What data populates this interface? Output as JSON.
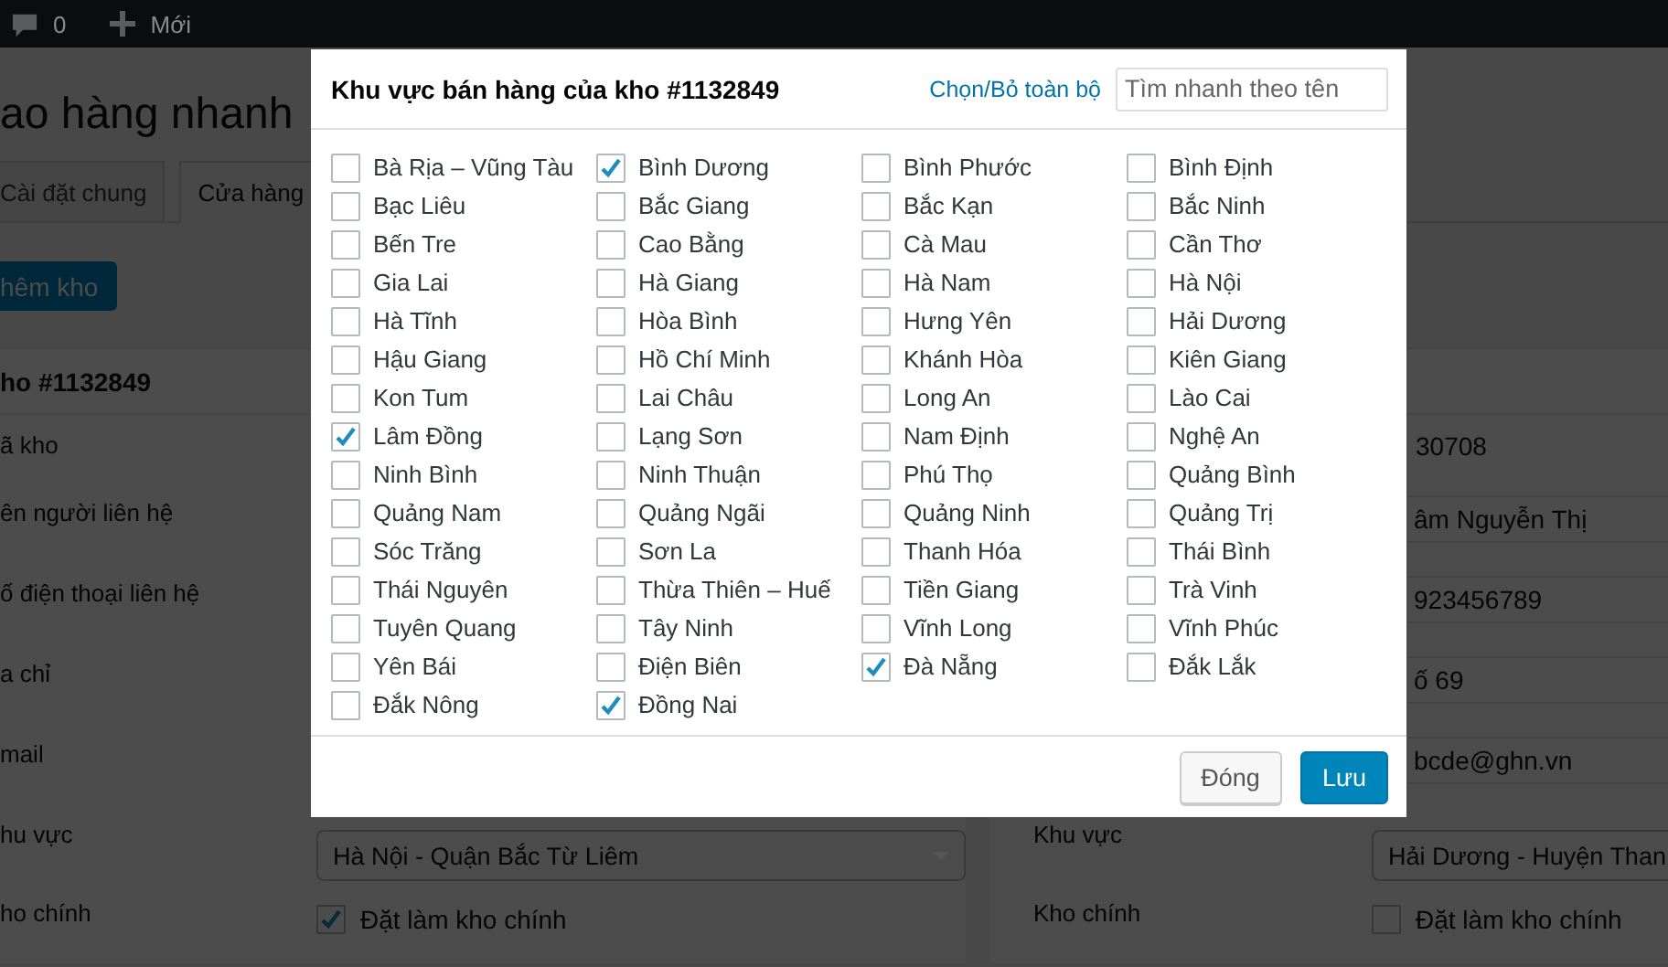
{
  "admin_bar": {
    "comments_count": "0",
    "new_label": "Mới"
  },
  "page_title": "ao hàng nhanh",
  "tabs": [
    {
      "label": "Cài đặt chung",
      "selected": false
    },
    {
      "label": "Cửa hàng",
      "selected": true
    }
  ],
  "add_button": "hêm kho",
  "warehouse_left": {
    "title": "ho #1132849",
    "labels": [
      "ã kho",
      "ên người liên hệ",
      "ố điện thoại liên hệ",
      "a chỉ",
      "mail",
      "hu vực",
      "ho chính"
    ],
    "region_select": "Hà Nội - Quận Bắc Từ Liêm",
    "main_checkbox": {
      "label": "Đặt làm kho chính",
      "checked": true
    }
  },
  "warehouse_right": {
    "code": "30708",
    "inputs": [
      "âm Nguyễn Thị",
      "923456789",
      "ố 69",
      "bcde@ghn.vn"
    ],
    "region_label": "Khu vực",
    "region_select": "Hải Dương - Huyện Than",
    "main_label": "Kho chính",
    "main_checkbox": {
      "label": "Đặt làm kho chính",
      "checked": false
    }
  },
  "dialog": {
    "title": "Khu vực bán hàng của kho #1132849",
    "toggle_all_link": "Chọn/Bỏ toàn bộ",
    "search": {
      "placeholder": "Tìm nhanh theo tên"
    },
    "provinces": [
      {
        "name": "Bà Rịa – Vũng Tàu",
        "checked": false
      },
      {
        "name": "Bình Dương",
        "checked": true
      },
      {
        "name": "Bình Phước",
        "checked": false
      },
      {
        "name": "Bình Định",
        "checked": false
      },
      {
        "name": "Bạc Liêu",
        "checked": false
      },
      {
        "name": "Bắc Giang",
        "checked": false
      },
      {
        "name": "Bắc Kạn",
        "checked": false
      },
      {
        "name": "Bắc Ninh",
        "checked": false
      },
      {
        "name": "Bến Tre",
        "checked": false
      },
      {
        "name": "Cao Bằng",
        "checked": false
      },
      {
        "name": "Cà Mau",
        "checked": false
      },
      {
        "name": "Cần Thơ",
        "checked": false
      },
      {
        "name": "Gia Lai",
        "checked": false
      },
      {
        "name": "Hà Giang",
        "checked": false
      },
      {
        "name": "Hà Nam",
        "checked": false
      },
      {
        "name": "Hà Nội",
        "checked": false
      },
      {
        "name": "Hà Tĩnh",
        "checked": false
      },
      {
        "name": "Hòa Bình",
        "checked": false
      },
      {
        "name": "Hưng Yên",
        "checked": false
      },
      {
        "name": "Hải Dương",
        "checked": false
      },
      {
        "name": "Hậu Giang",
        "checked": false
      },
      {
        "name": "Hồ Chí Minh",
        "checked": false
      },
      {
        "name": "Khánh Hòa",
        "checked": false
      },
      {
        "name": "Kiên Giang",
        "checked": false
      },
      {
        "name": "Kon Tum",
        "checked": false
      },
      {
        "name": "Lai Châu",
        "checked": false
      },
      {
        "name": "Long An",
        "checked": false
      },
      {
        "name": "Lào Cai",
        "checked": false
      },
      {
        "name": "Lâm Đồng",
        "checked": true
      },
      {
        "name": "Lạng Sơn",
        "checked": false
      },
      {
        "name": "Nam Định",
        "checked": false
      },
      {
        "name": "Nghệ An",
        "checked": false
      },
      {
        "name": "Ninh Bình",
        "checked": false
      },
      {
        "name": "Ninh Thuận",
        "checked": false
      },
      {
        "name": "Phú Thọ",
        "checked": false
      },
      {
        "name": "Quảng Bình",
        "checked": false
      },
      {
        "name": "Quảng Nam",
        "checked": false
      },
      {
        "name": "Quảng Ngãi",
        "checked": false
      },
      {
        "name": "Quảng Ninh",
        "checked": false
      },
      {
        "name": "Quảng Trị",
        "checked": false
      },
      {
        "name": "Sóc Trăng",
        "checked": false
      },
      {
        "name": "Sơn La",
        "checked": false
      },
      {
        "name": "Thanh Hóa",
        "checked": false
      },
      {
        "name": "Thái Bình",
        "checked": false
      },
      {
        "name": "Thái Nguyên",
        "checked": false
      },
      {
        "name": "Thừa Thiên – Huế",
        "checked": false
      },
      {
        "name": "Tiền Giang",
        "checked": false
      },
      {
        "name": "Trà Vinh",
        "checked": false
      },
      {
        "name": "Tuyên Quang",
        "checked": false
      },
      {
        "name": "Tây Ninh",
        "checked": false
      },
      {
        "name": "Vĩnh Long",
        "checked": false
      },
      {
        "name": "Vĩnh Phúc",
        "checked": false
      },
      {
        "name": "Yên Bái",
        "checked": false
      },
      {
        "name": "Điện Biên",
        "checked": false
      },
      {
        "name": "Đà Nẵng",
        "checked": true
      },
      {
        "name": "Đắk Lắk",
        "checked": false
      },
      {
        "name": "Đắk Nông",
        "checked": false
      },
      {
        "name": "Đồng Nai",
        "checked": true
      }
    ],
    "buttons": [
      {
        "label": "Đóng",
        "kind": "secondary"
      },
      {
        "label": "Lưu",
        "kind": "primary"
      }
    ]
  }
}
